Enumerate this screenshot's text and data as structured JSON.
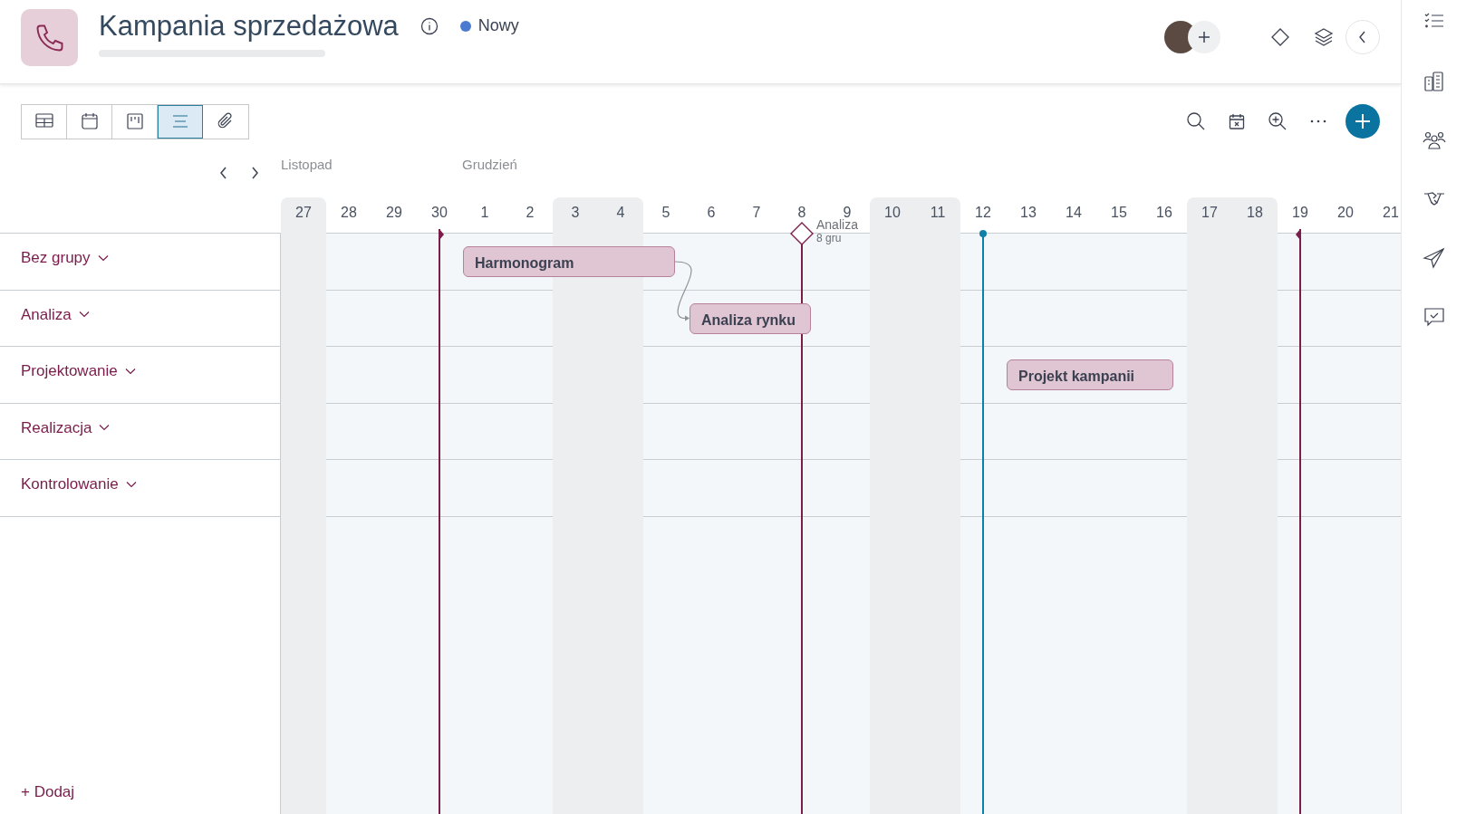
{
  "header": {
    "title": "Kampania sprzedażowa",
    "status": {
      "label": "Nowy",
      "color": "#4a7bd0"
    },
    "progress": {
      "level": 0
    }
  },
  "views": [
    {
      "kind": "table",
      "selected": false
    },
    {
      "kind": "calendar",
      "selected": false
    },
    {
      "kind": "board",
      "selected": false
    },
    {
      "kind": "list",
      "selected": true
    },
    {
      "kind": "attachment",
      "selected": false
    }
  ],
  "days": [
    {
      "label": "27",
      "weekend": true,
      "month": "Listopad"
    },
    {
      "label": "28",
      "weekend": false
    },
    {
      "label": "29",
      "weekend": false
    },
    {
      "label": "30",
      "weekend": false,
      "marker": {
        "kind": "start"
      }
    },
    {
      "label": "1",
      "weekend": false,
      "month": "Grudzień"
    },
    {
      "label": "2",
      "weekend": false
    },
    {
      "label": "3",
      "weekend": true
    },
    {
      "label": "4",
      "weekend": true
    },
    {
      "label": "5",
      "weekend": false
    },
    {
      "label": "6",
      "weekend": false
    },
    {
      "label": "7",
      "weekend": false
    },
    {
      "label": "8",
      "weekend": false,
      "marker": {
        "kind": "milestone",
        "label": "Analiza",
        "date": "8 gru"
      }
    },
    {
      "label": "9",
      "weekend": false
    },
    {
      "label": "10",
      "weekend": true
    },
    {
      "label": "11",
      "weekend": true
    },
    {
      "label": "12",
      "weekend": false,
      "marker": {
        "kind": "today"
      }
    },
    {
      "label": "13",
      "weekend": false
    },
    {
      "label": "14",
      "weekend": false
    },
    {
      "label": "15",
      "weekend": false
    },
    {
      "label": "16",
      "weekend": false
    },
    {
      "label": "17",
      "weekend": true
    },
    {
      "label": "18",
      "weekend": true
    },
    {
      "label": "19",
      "weekend": false,
      "marker": {
        "kind": "end"
      }
    },
    {
      "label": "20",
      "weekend": false
    },
    {
      "label": "21",
      "weekend": false
    }
  ],
  "groups": [
    {
      "label": "Bez grupy",
      "tasks": [
        {
          "label": "Harmonogram",
          "linked_to_next": true
        }
      ]
    },
    {
      "label": "Analiza",
      "tasks": [
        {
          "label": "Analiza rynku",
          "linked_to_next": false
        }
      ]
    },
    {
      "label": "Projektowanie",
      "tasks": [
        {
          "label": "Projekt kampanii",
          "linked_to_next": false
        }
      ]
    },
    {
      "label": "Realizacja"
    },
    {
      "label": "Kontrolowanie"
    }
  ],
  "add_label": "+ Dodaj"
}
